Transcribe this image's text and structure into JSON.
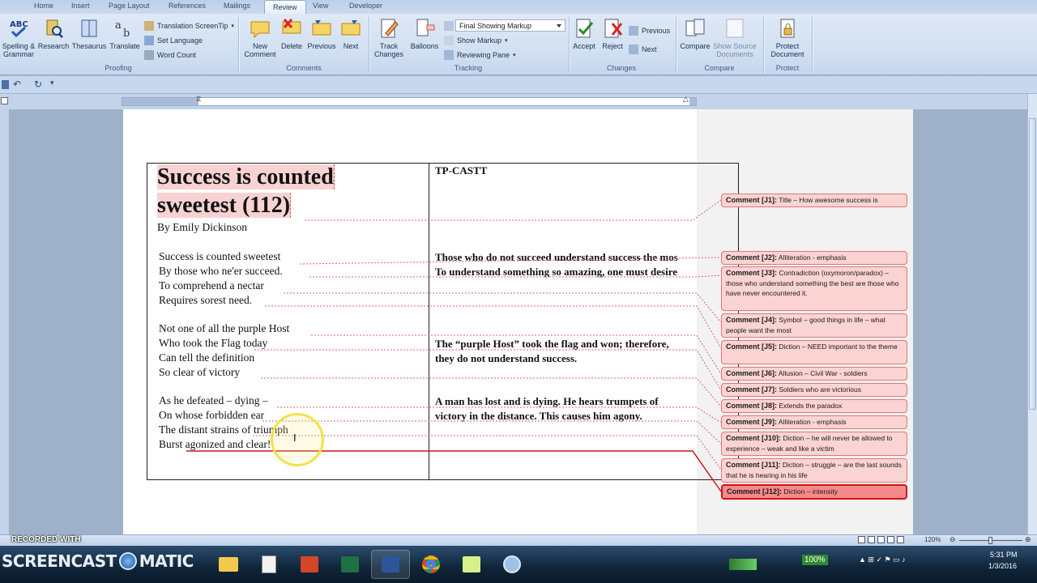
{
  "ribbon": {
    "tabs": [
      "Home",
      "Insert",
      "Page Layout",
      "References",
      "Mailings",
      "Review",
      "View",
      "Developer"
    ],
    "active_tab": "Review",
    "proofing": {
      "spelling_grammar": "Spelling & Grammar",
      "research": "Research",
      "thesaurus": "Thesaurus",
      "translate": "Translate",
      "translation_screentip": "Translation ScreenTip",
      "set_language": "Set Language",
      "word_count": "Word Count",
      "label": "Proofing"
    },
    "comments": {
      "new_comment": "New Comment",
      "delete": "Delete",
      "previous": "Previous",
      "next": "Next",
      "label": "Comments"
    },
    "tracking": {
      "track_changes": "Track Changes",
      "balloons": "Balloons",
      "display": "Final Showing Markup",
      "show_markup": "Show Markup",
      "reviewing_pane": "Reviewing Pane",
      "label": "Tracking"
    },
    "changes": {
      "accept": "Accept",
      "reject": "Reject",
      "previous": "Previous",
      "next": "Next",
      "label": "Changes"
    },
    "compare": {
      "compare": "Compare",
      "show_source": "Show Source Documents",
      "label": "Compare"
    },
    "protect": {
      "protect_document": "Protect Document",
      "label": "Protect"
    }
  },
  "document": {
    "title_line1": "Success is counted",
    "title_line2": "sweetest (112)",
    "author": "By Emily Dickinson",
    "right_header": "TP-CASTT",
    "stanzas": [
      [
        "Success is counted sweetest",
        "By those who ne'er succeed.",
        "To comprehend a nectar",
        "Requires sorest need."
      ],
      [
        "Not one of all the purple Host",
        "Who took the Flag today",
        "Can tell the definition",
        "So clear of victory"
      ],
      [
        "As he defeated – dying –",
        "On whose forbidden ear",
        "The distant strains of triumph",
        "Burst agonized and clear!"
      ]
    ],
    "analysis": [
      [
        "Those who do not succeed  understand success  the mos",
        "To understand something so amazing, one must desire"
      ],
      [
        "The “purple Host” took the flag and won; therefore,",
        "they do not understand success."
      ],
      [
        "A man has lost and is dying. He hears trumpets of",
        "victory in the distance.  This causes him agony."
      ]
    ]
  },
  "comments": [
    {
      "id": "Comment [J1]:",
      "text": "Title – How awesome success is"
    },
    {
      "id": "Comment [J2]:",
      "text": "Alliteration - emphasis"
    },
    {
      "id": "Comment [J3]:",
      "text": "Contradiction (oxymoron/paradox) – those who understand something the best are those who have never encountered it."
    },
    {
      "id": "Comment [J4]:",
      "text": "Symbol – good things in life – what people want the most"
    },
    {
      "id": "Comment [J5]:",
      "text": "Diction – NEED important to the theme"
    },
    {
      "id": "Comment [J6]:",
      "text": "Allusion – Civil War - soldiers"
    },
    {
      "id": "Comment [J7]:",
      "text": "Soldiers who are victorious"
    },
    {
      "id": "Comment [J8]:",
      "text": "Extends the paradox"
    },
    {
      "id": "Comment [J9]:",
      "text": "Alliteration - emphasis"
    },
    {
      "id": "Comment [J10]:",
      "text": "Diction – he will never be allowed to experience – weak and like a victim"
    },
    {
      "id": "Comment [J11]:",
      "text": "Diction – struggle – are the last sounds that he is hearing in his life"
    },
    {
      "id": "Comment [J12]:",
      "text": "Diction – intensity"
    }
  ],
  "status_bar": {
    "zoom": "120%"
  },
  "taskbar": {
    "brand": "SCREENCAST",
    "brand2": "MATIC",
    "recorded": "RECORDED WITH",
    "battery": "100%",
    "time": "5:31 PM",
    "date": "1/3/2016"
  }
}
